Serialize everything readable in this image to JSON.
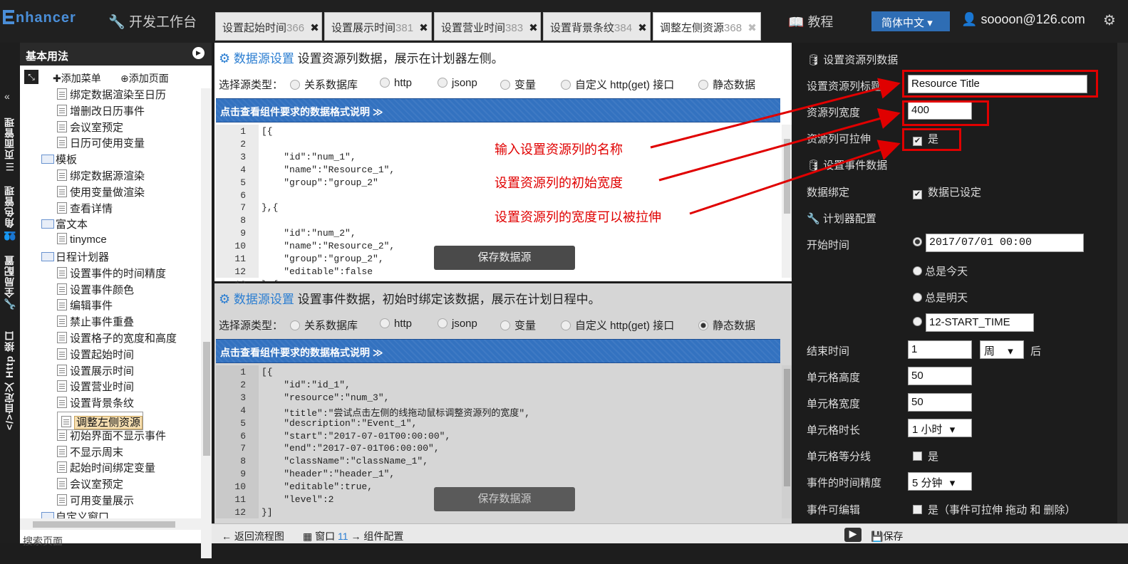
{
  "app": {
    "logo": "nhancer",
    "devtool": "开发工作台",
    "tutorial": "教程",
    "language": "简体中文",
    "user": "soooon@126.com"
  },
  "tabs": [
    {
      "label": "设置起始时间",
      "num": "366"
    },
    {
      "label": "设置展示时间",
      "num": "381"
    },
    {
      "label": "设置营业时间",
      "num": "383"
    },
    {
      "label": "设置背景条纹",
      "num": "384"
    },
    {
      "label": "调整左侧资源",
      "num": "368"
    }
  ],
  "vnav": [
    "页面管理",
    "角色管理",
    "全局配置",
    "自定义 Http 接口"
  ],
  "tree": {
    "title": "基本用法",
    "add_menu": "添加菜单",
    "add_page": "添加页面",
    "items": [
      {
        "label": "绑定数据渲染至日历",
        "type": "doc"
      },
      {
        "label": "增删改日历事件",
        "type": "doc"
      },
      {
        "label": "会议室预定",
        "type": "doc"
      },
      {
        "label": "日历可使用变量",
        "type": "doc"
      },
      {
        "label": "模板",
        "type": "folder"
      },
      {
        "label": "绑定数据源渲染",
        "type": "doc"
      },
      {
        "label": "使用变量做渲染",
        "type": "doc"
      },
      {
        "label": "查看详情",
        "type": "doc"
      },
      {
        "label": "富文本",
        "type": "folder"
      },
      {
        "label": "tinymce",
        "type": "doc"
      },
      {
        "label": "日程计划器",
        "type": "folder"
      },
      {
        "label": "设置事件的时间精度",
        "type": "doc"
      },
      {
        "label": "设置事件颜色",
        "type": "doc"
      },
      {
        "label": "编辑事件",
        "type": "doc"
      },
      {
        "label": "禁止事件重叠",
        "type": "doc"
      },
      {
        "label": "设置格子的宽度和高度",
        "type": "doc"
      },
      {
        "label": "设置起始时间",
        "type": "doc"
      },
      {
        "label": "设置展示时间",
        "type": "doc"
      },
      {
        "label": "设置营业时间",
        "type": "doc"
      },
      {
        "label": "设置背景条纹",
        "type": "doc"
      },
      {
        "label": "调整左侧资源",
        "type": "doc",
        "selected": true
      },
      {
        "label": "初始界面不显示事件",
        "type": "doc"
      },
      {
        "label": "不显示周末",
        "type": "doc"
      },
      {
        "label": "起始时间绑定变量",
        "type": "doc"
      },
      {
        "label": "会议室预定",
        "type": "doc"
      },
      {
        "label": "可用变量展示",
        "type": "doc"
      },
      {
        "label": "自定义窗口",
        "type": "folder"
      }
    ],
    "search": "搜索页面"
  },
  "panel1": {
    "title": "数据源设置",
    "desc": "设置资源列数据，展示在计划器左侧。",
    "source_label": "选择源类型：",
    "sources": [
      "关系数据库",
      "http",
      "jsonp",
      "变量",
      "自定义 http(get) 接口",
      "静态数据"
    ],
    "selected_source": -1,
    "format_bar": "点击查看组件要求的数据格式说明 ≫",
    "code": [
      "[{",
      "",
      "    \"id\":\"num_1\",",
      "    \"name\":\"Resource_1\",",
      "    \"group\":\"group_2\"",
      "",
      "},{",
      "",
      "    \"id\":\"num_2\",",
      "    \"name\":\"Resource_2\",",
      "    \"group\":\"group_2\",",
      "    \"editable\":false",
      "},{"
    ],
    "save": "保存数据源"
  },
  "panel2": {
    "title": "数据源设置",
    "desc": "设置事件数据，初始时绑定该数据，展示在计划日程中。",
    "source_label": "选择源类型：",
    "sources": [
      "关系数据库",
      "http",
      "jsonp",
      "变量",
      "自定义 http(get) 接口",
      "静态数据"
    ],
    "selected_source": 5,
    "format_bar": "点击查看组件要求的数据格式说明 ≫",
    "code": [
      "[{",
      "    \"id\":\"id_1\",",
      "    \"resource\":\"num_3\",",
      "    \"title\":\"尝试点击左侧的线拖动鼠标调整资源列的宽度\",",
      "    \"description\":\"Event_1\",",
      "    \"start\":\"2017-07-01T00:00:00\",",
      "    \"end\":\"2017-07-01T06:00:00\",",
      "    \"className\":\"className_1\",",
      "    \"header\":\"header_1\",",
      "    \"editable\":true,",
      "    \"level\":2",
      "}]"
    ],
    "save": "保存数据源"
  },
  "right": {
    "res_section": "设置资源列数据",
    "res_title_label": "设置资源列标题",
    "res_title_value": "Resource Title",
    "res_width_label": "资源列宽度",
    "res_width_value": "400",
    "res_resizable_label": "资源列可拉伸",
    "yes": "是",
    "event_section": "设置事件数据",
    "binding_label": "数据绑定",
    "binding_value": "数据已设定",
    "planner_section": "计划器配置",
    "start_label": "开始时间",
    "start_value": "2017/07/01 00:00",
    "always_today": "总是今天",
    "always_tomorrow": "总是明天",
    "start_var": "12-START_TIME",
    "end_label": "结束时间",
    "end_value": "1",
    "end_unit": "周",
    "end_after": "后",
    "cell_height_label": "单元格高度",
    "cell_height_value": "50",
    "cell_width_label": "单元格宽度",
    "cell_width_value": "50",
    "cell_duration_label": "单元格时长",
    "cell_duration_value": "1 小时",
    "cell_split_label": "单元格等分线",
    "event_precision_label": "事件的时间精度",
    "event_precision_value": "5 分钟",
    "editable_label": "事件可编辑",
    "editable_value": "是（事件可拉伸 拖动 和 删除）"
  },
  "annotations": [
    "输入设置资源列的名称",
    "设置资源列的初始宽度",
    "设置资源列的宽度可以被拉伸"
  ],
  "bottom": {
    "back": "返回流程图",
    "window": "窗口",
    "window_num": "11",
    "component": "组件配置",
    "save": "保存"
  },
  "colors": {
    "accent": "#2a7dd1",
    "annotation": "#e00000",
    "format_bar": "#3372c0"
  }
}
